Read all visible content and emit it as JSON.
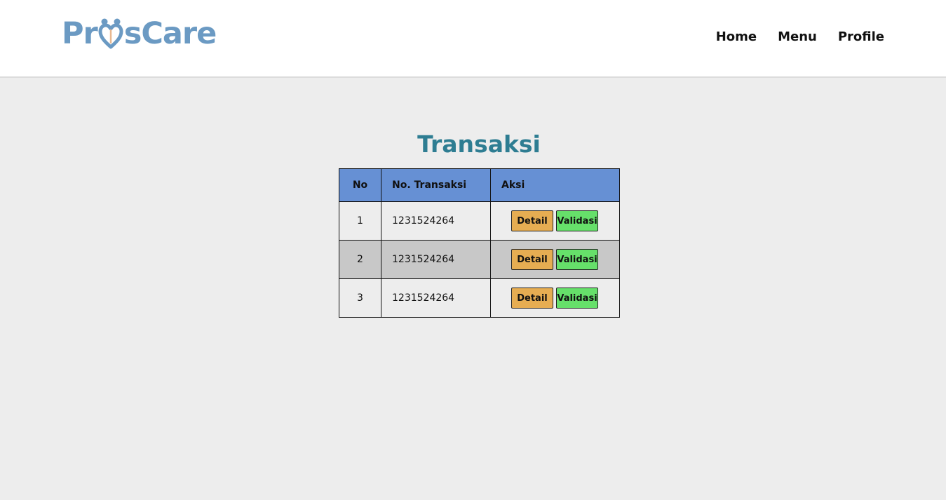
{
  "header": {
    "logo": {
      "text_before": "Pr",
      "text_after": "sCare",
      "full_text": "ProsCare"
    },
    "nav": [
      {
        "label": "Home"
      },
      {
        "label": "Menu"
      },
      {
        "label": "Profile"
      }
    ]
  },
  "main": {
    "title": "Transaksi",
    "table": {
      "headers": [
        "No",
        "No. Transaksi",
        "Aksi"
      ],
      "rows": [
        {
          "no": "1",
          "transaction_no": "1231524264",
          "detail_label": "Detail",
          "validate_label": "Validasi"
        },
        {
          "no": "2",
          "transaction_no": "1231524264",
          "detail_label": "Detail",
          "validate_label": "Validasi"
        },
        {
          "no": "3",
          "transaction_no": "1231524264",
          "detail_label": "Detail",
          "validate_label": "Validasi"
        }
      ]
    }
  },
  "colors": {
    "logo": "#6b9ac3",
    "title": "#2e7d92",
    "table_header": "#6690d4",
    "detail_button": "#e6ad52",
    "validate_button": "#66e06a",
    "page_background": "#ededed",
    "alt_row": "#c8c8c8"
  }
}
